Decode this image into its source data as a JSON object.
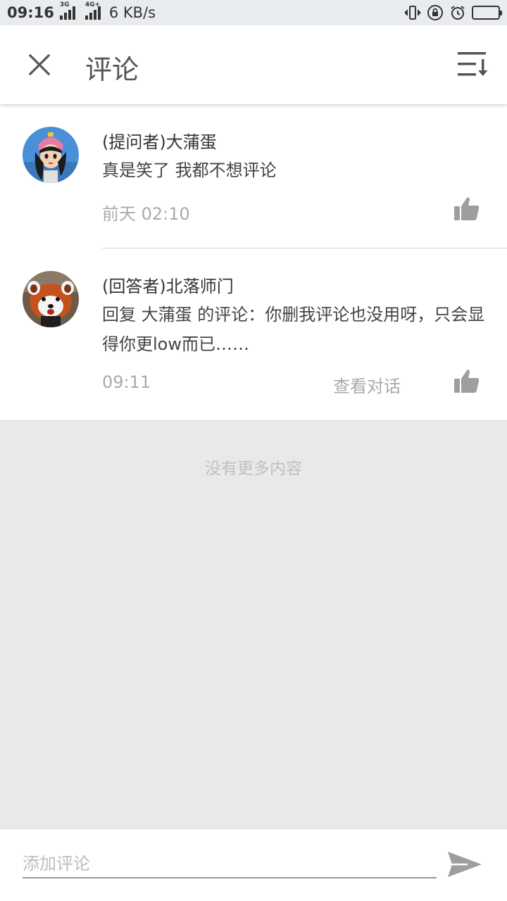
{
  "status_bar": {
    "time": "09:16",
    "signal1_tag": "3G",
    "signal2_tag": "4G+",
    "speed": "6 KB/s"
  },
  "app_bar": {
    "title": "评论"
  },
  "comments": [
    {
      "author": "(提问者)大蒲蛋",
      "content": "真是笑了  我都不想评论",
      "time": "前天  02:10"
    },
    {
      "author": "(回答者)北落师门",
      "content": "回复  大蒲蛋  的评论：你删我评论也没用呀，只会显得你更low而已……",
      "time": "09:11",
      "view_dialog": "查看对话"
    }
  ],
  "footer": {
    "no_more": "没有更多内容"
  },
  "input": {
    "placeholder": "添加评论"
  },
  "colors": {
    "background": "#e9e9e9",
    "icon_gray": "#9e9e9e",
    "text_dark": "#333333",
    "text_light": "#aaaaaa"
  }
}
